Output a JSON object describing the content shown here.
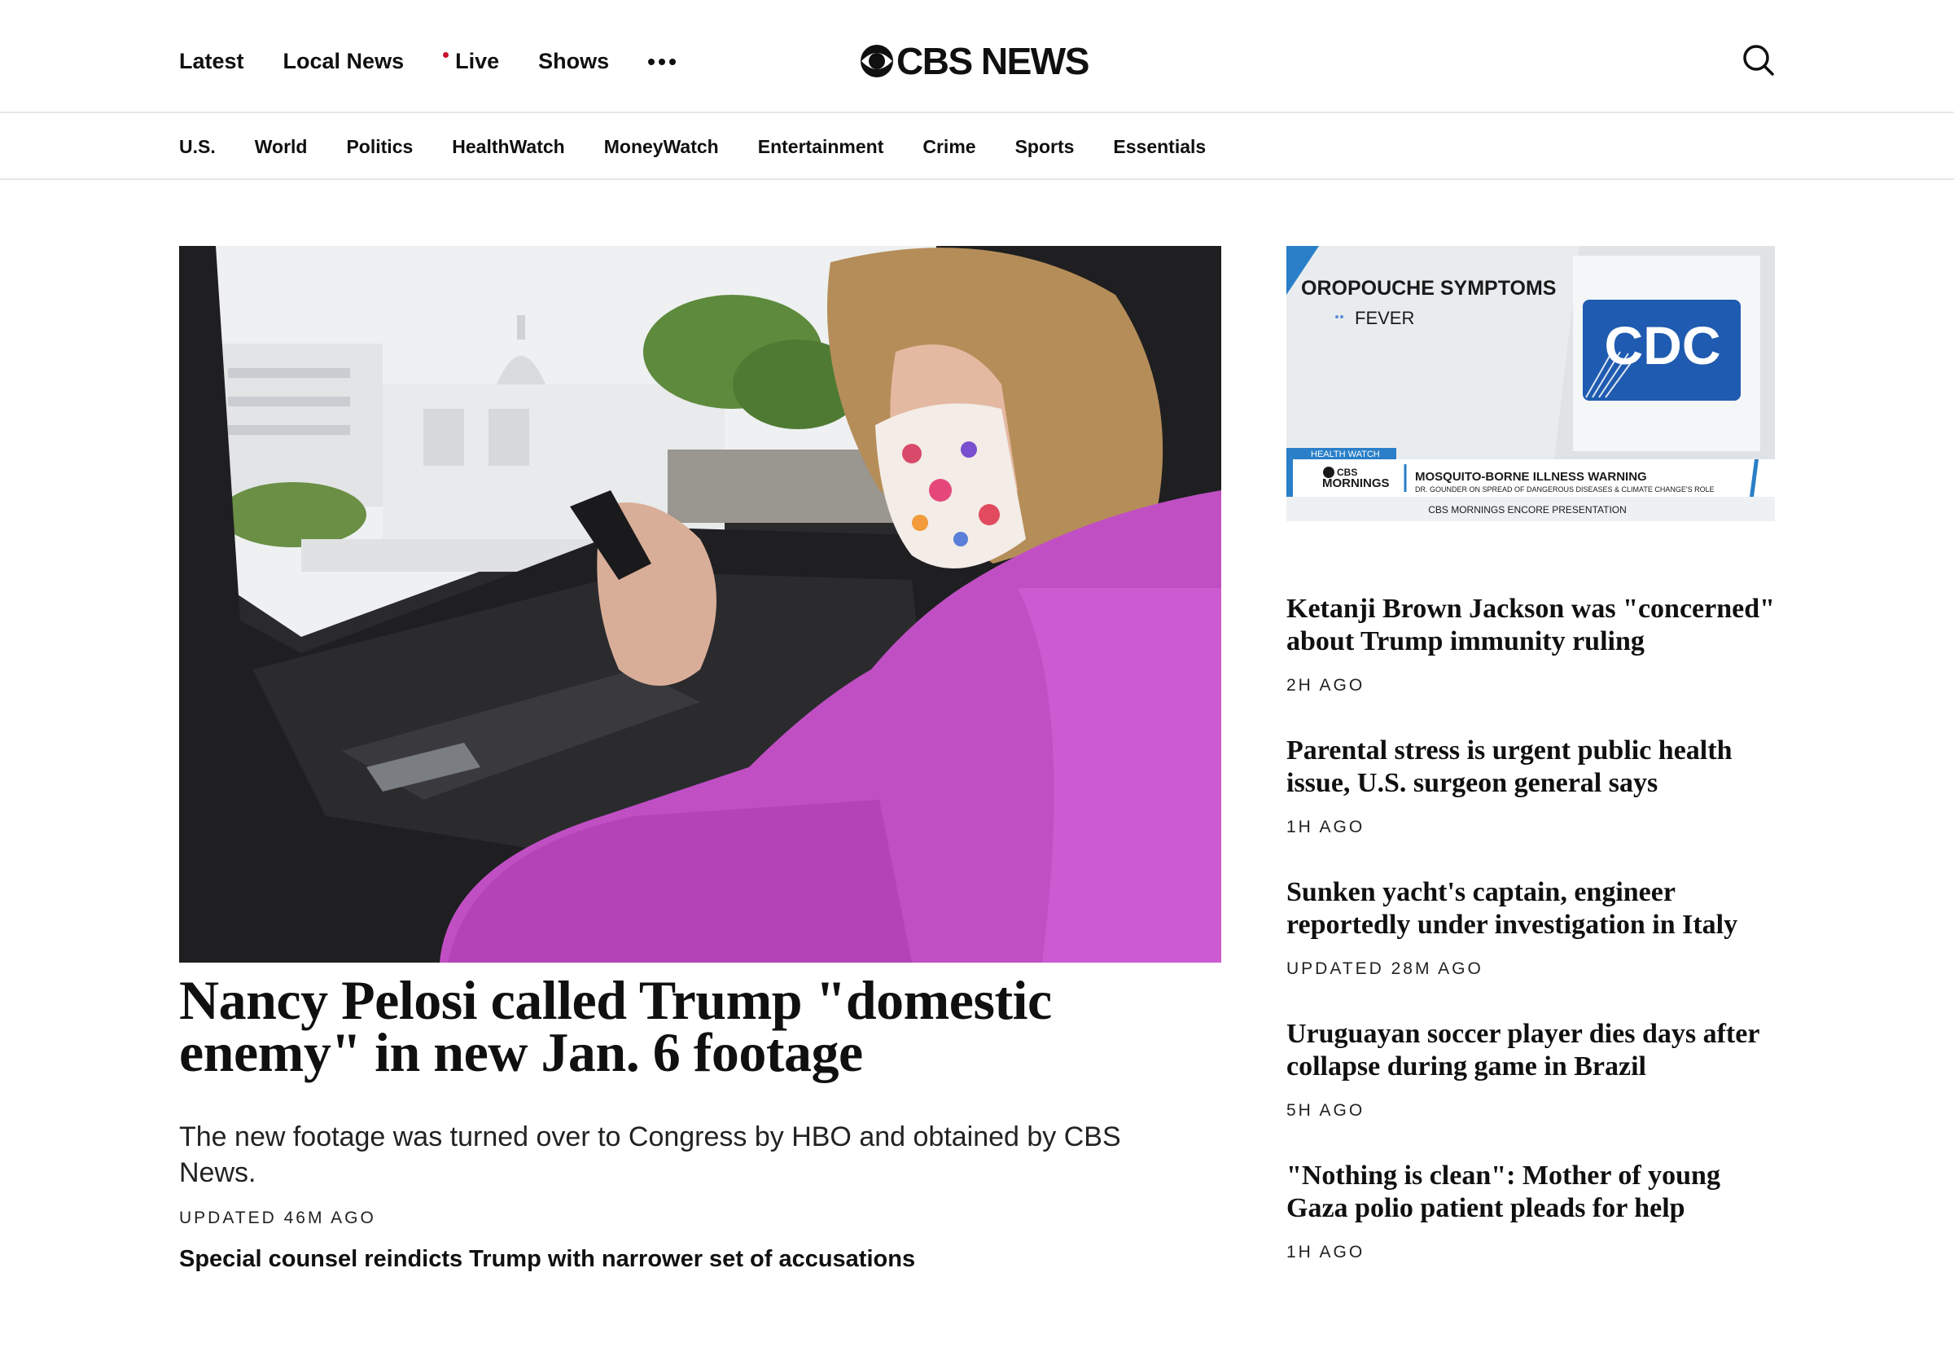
{
  "header": {
    "nav": [
      {
        "label": "Latest",
        "live": false
      },
      {
        "label": "Local News",
        "live": false
      },
      {
        "label": "Live",
        "live": true
      },
      {
        "label": "Shows",
        "live": false
      }
    ],
    "logo_text": "CBS NEWS",
    "more_icon": "more-dots-icon",
    "search_icon": "search-icon"
  },
  "sections": [
    "U.S.",
    "World",
    "Politics",
    "HealthWatch",
    "MoneyWatch",
    "Entertainment",
    "Crime",
    "Sports",
    "Essentials"
  ],
  "lead": {
    "headline": "Nancy Pelosi called Trump \"domestic enemy\" in new Jan. 6 footage",
    "dek": "The new footage was turned over to Congress by HBO and obtained by CBS News.",
    "time": "UPDATED 46M AGO",
    "related": "Special counsel reindicts Trump with narrower set of accusations"
  },
  "video": {
    "title": "OROPOUCHE SYMPTOMS",
    "bullet": "FEVER",
    "badge": "CDC",
    "category": "HEALTH WATCH",
    "show_line1": "CBS",
    "show_line2": "MORNINGS",
    "ticker": "MOSQUITO-BORNE ILLNESS WARNING",
    "ticker_sub": "DR. GOUNDER ON SPREAD OF DANGEROUS DISEASES & CLIMATE CHANGE'S ROLE",
    "encore": "CBS MORNINGS ENCORE PRESENTATION"
  },
  "side_stories": [
    {
      "title": "Ketanji Brown Jackson was \"concerned\" about Trump immunity ruling",
      "time": "2H AGO"
    },
    {
      "title": "Parental stress is urgent public health issue, U.S. surgeon general says",
      "time": "1H AGO"
    },
    {
      "title": "Sunken yacht's captain, engineer reportedly under investigation in Italy",
      "time": "UPDATED 28M AGO"
    },
    {
      "title": "Uruguayan soccer player dies days after collapse during game in Brazil",
      "time": "5H AGO"
    },
    {
      "title": "\"Nothing is clean\": Mother of young Gaza polio patient pleads for help",
      "time": "1H AGO"
    }
  ],
  "colors": {
    "live_dot": "#c8102e",
    "jacket": "#c14fc4",
    "cdc_blue": "#1f5bb0",
    "ticker_blue": "#2a7fc8"
  }
}
